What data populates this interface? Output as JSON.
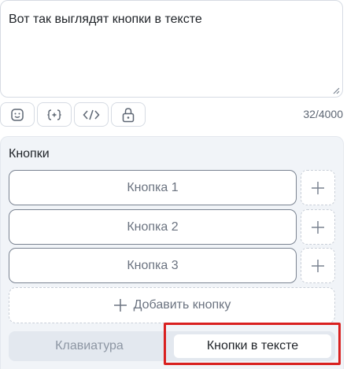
{
  "message": {
    "text": "Вот так выглядят кнопки в тексте",
    "counter": "32/4000"
  },
  "toolbar": {
    "tools": [
      "emoji-icon",
      "variable-icon",
      "code-icon",
      "lock-icon"
    ]
  },
  "buttons_panel": {
    "title": "Кнопки",
    "buttons": [
      {
        "label": "Кнопка 1"
      },
      {
        "label": "Кнопка 2"
      },
      {
        "label": "Кнопка 3"
      }
    ],
    "add_label": "Добавить кнопку"
  },
  "mode_switch": {
    "keyboard_label": "Клавиатура",
    "inline_label": "Кнопки в тексте",
    "selected": "Кнопки в тексте"
  },
  "colors": {
    "highlight": "#d9201f",
    "panel_bg": "#f1f4f8"
  }
}
